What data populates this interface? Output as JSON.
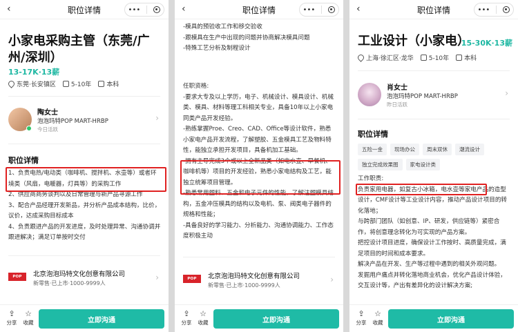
{
  "nav": {
    "title": "职位详情",
    "back": "‹",
    "menu": "•••",
    "minus": "—"
  },
  "footer": {
    "share": "分享",
    "collect": "收藏",
    "cta": "立即沟通",
    "share_icon": "share-icon",
    "star_icon": "star-icon"
  },
  "company": {
    "logo": "POP MART",
    "name": "北京泡泡玛特文化创意有限公司",
    "meta": "新零售·已上市·1000-9999人"
  },
  "recruiter_p1": {
    "name": "陶女士",
    "org": "泡泡玛特POP MART-HRBP",
    "active": "今日活跃"
  },
  "recruiter_p3": {
    "name": "肖女士",
    "org": "泡泡玛特POP MART-HRBP",
    "active": "昨日活跃"
  },
  "panel1": {
    "title": "小家电采购主管（东莞/广州/深圳）",
    "salary": "13-17K·13薪",
    "location": "东莞·长安镇区",
    "experience": "5-10年",
    "education": "本科",
    "section": "职位详情",
    "lines": [
      "1、负责电热/电动类（咖啡机、搅拌机、水壶等）或者环境类（风扇，电暖器，灯具等）的采购工作",
      "2、供应商商务谈判以及日常管理与新产品寻源工作",
      "3、配合产品经理开发新品，并分析产品成本结构，比价，议价，达成采购目标成本",
      "4、负责跟进产品的开发进度，及时处理异常、沟通协调并跟进解决；满足订单按时交付"
    ]
  },
  "panel2": {
    "top_lines": [
      "-模具的预验收工作和移交验收",
      "-跟模具在生产中出现的问题并协商解决模具问题",
      "-特殊工艺分析及制程设计"
    ],
    "req_title": "任职资格:",
    "req_lines": [
      "-要求大专及以上学历，电子、机械设计、模具设计、机械类、模具、材料等理工科相关专业，具备10年以上小家电同类产品开发经验。",
      "-熟练掌握Proe、Creo、CAD、Office等设计软件，熟悉小家电产品开发流程，了解塑胶、五金模具工艺及物料特性，能独立承担开发项目，具备机加工基础。",
      "-拥有主导完成3个或以上全新品类（如电水壶、早餐机、咖啡机等）项目的开发经验，熟悉小家电结构及工艺，能独立统筹项目管理。",
      "-熟悉常用塑料、五金和电子元件的性能，了解注塑模具结构，五金冲压模具的结构以及电机、泵、阀类电子器件的规格和性能；",
      "-具备良好的学习能力、分析能力、沟通协调能力、工作态度积极主动"
    ]
  },
  "panel3": {
    "title": "工业设计（小家电）",
    "salary": "15-30K·13薪",
    "location": "上海·徐汇区·龙华",
    "experience": "5-10年",
    "education": "本科",
    "section": "职位详情",
    "tags": [
      "五险一金",
      "现场办公",
      "周末双休",
      "潮流设计",
      "独立完成效果图",
      "家电设计类"
    ],
    "duty_title": "工作职责:",
    "lines": [
      "负责家用电器，如复古小冰箱，电水壶等家电产品的造型设计，CMF设计等工业设计内容，推动产品设计项目的转化落地；",
      "与跨部门团队（如创意、IP、研发，供应链等）紧密合作，将创意理念转化为可实现的产品方案。",
      "把控设计项目进度，确保设计工作按时、高质量完成，满足项目的时间和成本要求。",
      "解决产品在开发、生产等过程中遇到的相关外观问题。",
      "发掘用户痛点并转化落地商业机会，优化产品设计体验，交互设计等，产出有差异化的设计解决方案;"
    ]
  }
}
